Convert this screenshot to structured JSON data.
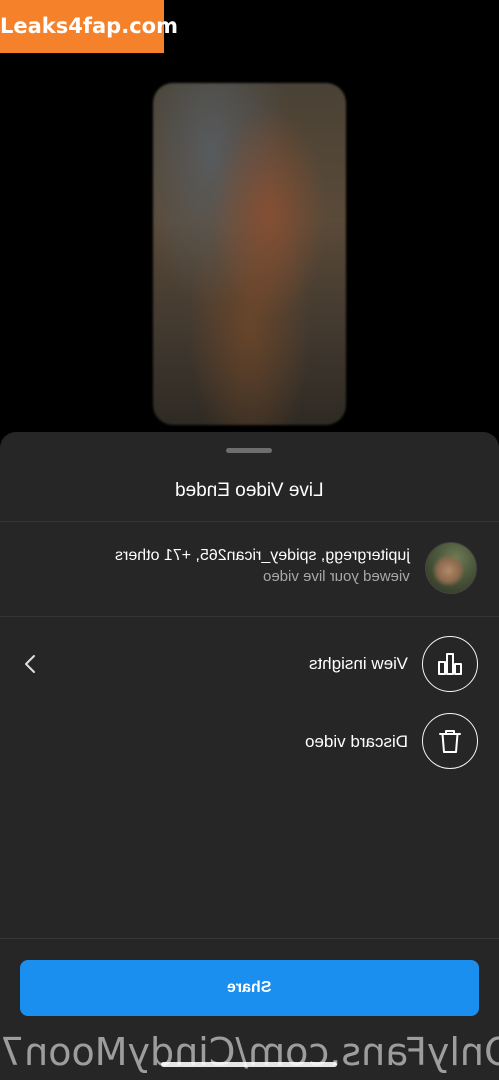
{
  "watermark_top": "Leaks4fap.com",
  "watermark_bottom": "OnlyFans.com/CindyMoon7",
  "sheet": {
    "title": "Live Video Ended",
    "viewers": {
      "names": "jupitergregg, spidey_rican265, +71 others",
      "subtitle": "viewed your live video"
    },
    "actions": [
      {
        "label": "View insights",
        "icon": "bar-chart-icon"
      },
      {
        "label": "Discard video",
        "icon": "trash-icon"
      }
    ],
    "share_label": "Share"
  },
  "colors": {
    "share": "#1a8ff0",
    "sheet_bg": "#262626",
    "watermark": "#f5822a"
  }
}
